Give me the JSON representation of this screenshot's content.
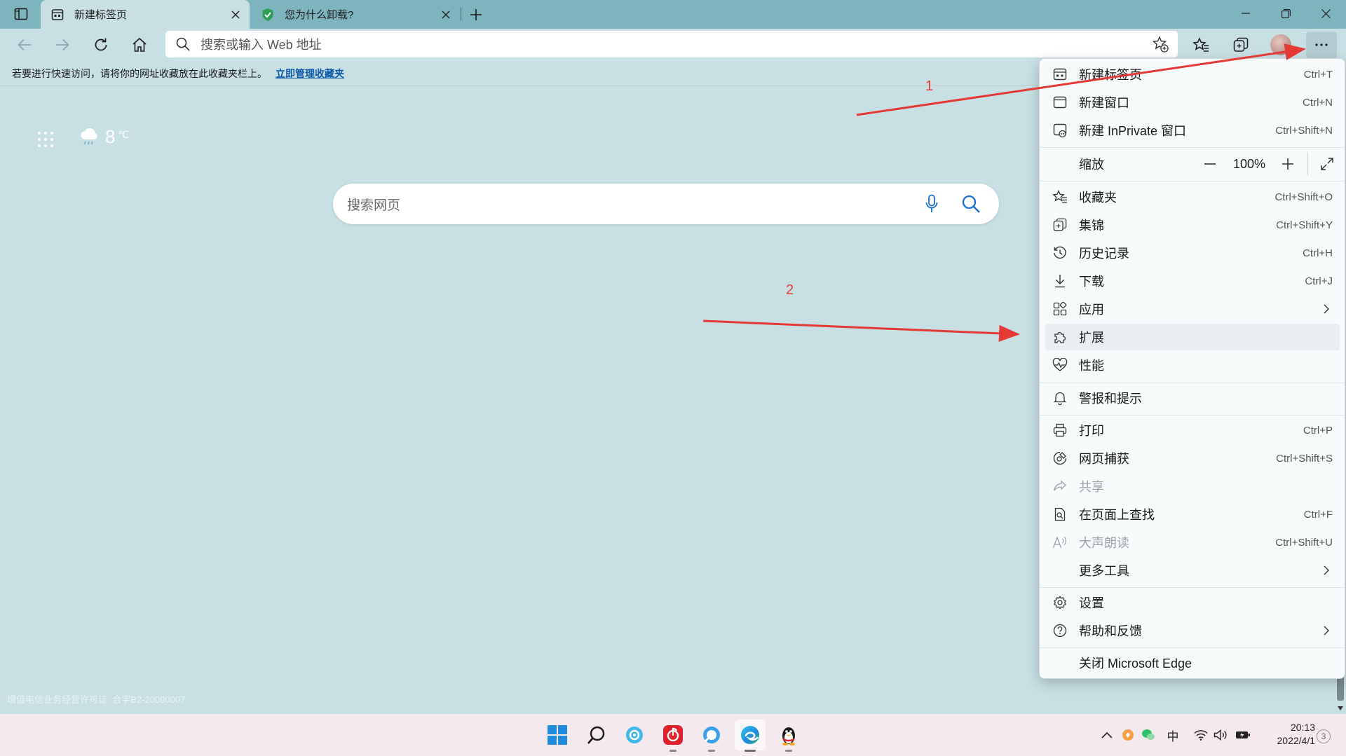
{
  "tabs": [
    {
      "title": "新建标签页",
      "active": true
    },
    {
      "title": "您为什么卸载?",
      "active": false
    }
  ],
  "address": {
    "placeholder": "搜索或输入 Web 地址"
  },
  "favorites_bar": {
    "hint": "若要进行快速访问，请将你的网址收藏放在此收藏夹栏上。",
    "link": "立即管理收藏夹"
  },
  "weather": {
    "temp": "8",
    "unit": "℃"
  },
  "page_search": {
    "placeholder": "搜索网页"
  },
  "license_text": "增值电信业务经营许可证: 合字B2-20090007",
  "annotations": [
    {
      "label": "1",
      "color": "#e53935"
    },
    {
      "label": "2",
      "color": "#e53935"
    }
  ],
  "menu": {
    "items": {
      "new_tab": {
        "label": "新建标签页",
        "shortcut": "Ctrl+T"
      },
      "new_window": {
        "label": "新建窗口",
        "shortcut": "Ctrl+N"
      },
      "new_inprivate": {
        "label": "新建 InPrivate 窗口",
        "shortcut": "Ctrl+Shift+N"
      },
      "favorites": {
        "label": "收藏夹",
        "shortcut": "Ctrl+Shift+O"
      },
      "collections": {
        "label": "集锦",
        "shortcut": "Ctrl+Shift+Y"
      },
      "history": {
        "label": "历史记录",
        "shortcut": "Ctrl+H"
      },
      "downloads": {
        "label": "下载",
        "shortcut": "Ctrl+J"
      },
      "apps": {
        "label": "应用"
      },
      "extensions": {
        "label": "扩展"
      },
      "performance": {
        "label": "性能"
      },
      "alerts": {
        "label": "警报和提示"
      },
      "print": {
        "label": "打印",
        "shortcut": "Ctrl+P"
      },
      "web_capture": {
        "label": "网页捕获",
        "shortcut": "Ctrl+Shift+S"
      },
      "share": {
        "label": "共享"
      },
      "find": {
        "label": "在页面上查找",
        "shortcut": "Ctrl+F"
      },
      "read_aloud": {
        "label": "大声朗读",
        "shortcut": "Ctrl+Shift+U"
      },
      "more_tools": {
        "label": "更多工具"
      },
      "settings": {
        "label": "设置"
      },
      "help": {
        "label": "帮助和反馈"
      },
      "close_edge": {
        "label": "关闭 Microsoft Edge"
      }
    },
    "zoom": {
      "label": "缩放",
      "value": "100%"
    }
  },
  "taskbar": {
    "ime": "中",
    "time": "20:13",
    "date": "2022/4/1",
    "notifications": "3"
  },
  "colors": {
    "accent_red": "#e53935",
    "link_blue": "#0b57a8"
  }
}
